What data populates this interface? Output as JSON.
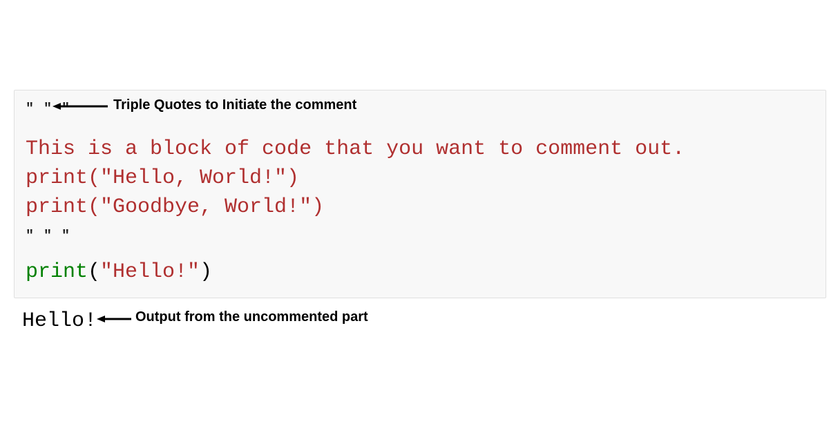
{
  "code": {
    "triple_quote_open": "\" \" \"",
    "comment_line_1": "This is a block of code that you want to comment out.",
    "comment_line_2": "print(\"Hello, World!\")",
    "comment_line_3": "print(\"Goodbye, World!\")",
    "triple_quote_close": "\" \" \"",
    "active_print_func": "print",
    "active_print_paren_open": "(",
    "active_print_arg": "\"Hello!\"",
    "active_print_paren_close": ")"
  },
  "output": {
    "text": "Hello!"
  },
  "annotations": {
    "top": "Triple Quotes to Initiate the comment",
    "bottom": "Output from the uncommented part"
  }
}
